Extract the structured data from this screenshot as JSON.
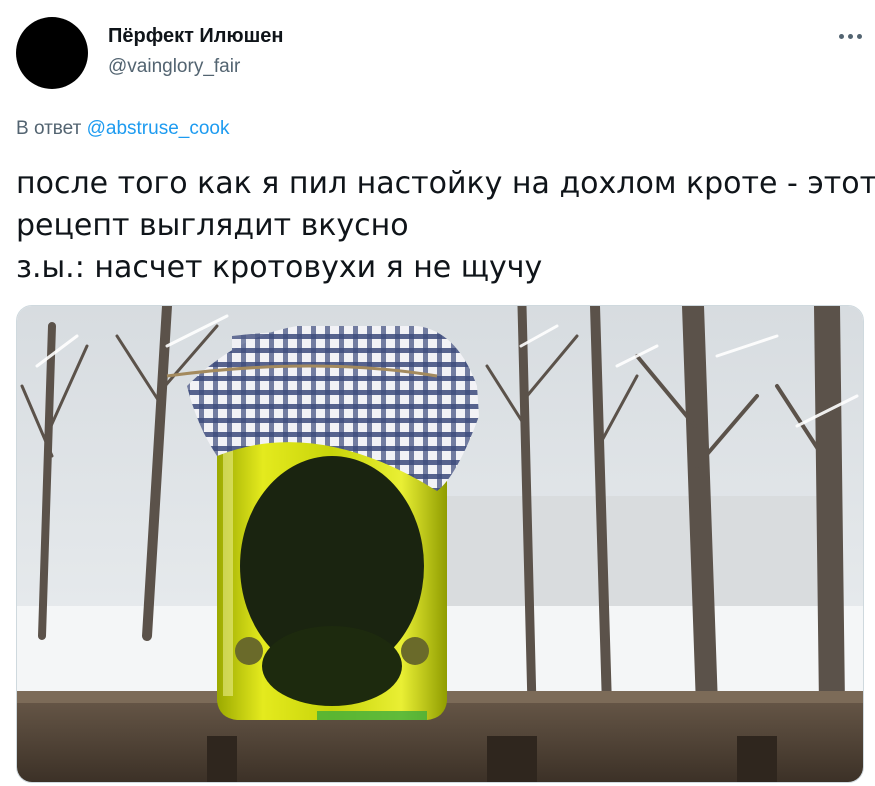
{
  "author": {
    "name": "Пёрфект Илюшен",
    "handle": "@vainglory_fair"
  },
  "reply": {
    "prefix": "В ответ",
    "handle": "@abstruse_cook"
  },
  "tweet": {
    "lines": [
      "после того как я пил настойку на дохлом кроте - этот",
      "рецепт выглядит вкусно",
      "з.ы.: насчет кротовухи я не щучу"
    ]
  },
  "icons": {
    "more": "more-horizontal-icon"
  },
  "colors": {
    "text": "#0f1419",
    "secondary": "#536471",
    "link": "#1d9bf0",
    "border": "#cfd9de"
  }
}
